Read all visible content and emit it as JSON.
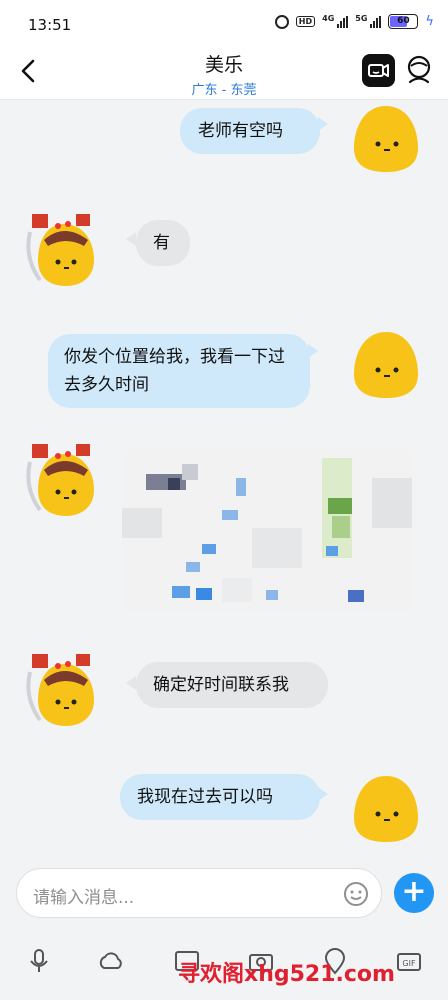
{
  "status_bar": {
    "time": "13:51",
    "hd_label": "HD",
    "network_4g": "4G",
    "network_5g": "5G",
    "battery": "60"
  },
  "header": {
    "title": "美乐",
    "subtitle": "广东 - 东莞"
  },
  "messages": [
    {
      "side": "me",
      "text": "老师有空吗"
    },
    {
      "side": "them",
      "text": "有"
    },
    {
      "side": "me",
      "text": "你发个位置给我，我看一下过去多久时间"
    },
    {
      "side": "them",
      "type": "location-map"
    },
    {
      "side": "them",
      "text": "确定好时间联系我"
    },
    {
      "side": "me",
      "text": "我现在过去可以吗"
    }
  ],
  "input": {
    "placeholder": "请输入消息..."
  },
  "toolbar_icons": [
    "mic-icon",
    "cloud-icon",
    "image-icon",
    "camera-icon",
    "location-icon",
    "gif-icon"
  ],
  "watermark": "寻欢阁xhg521.com",
  "colors": {
    "accent": "#2196f3",
    "my_bubble": "#cfe9fa",
    "their_bubble": "#e5e6e8",
    "subtitle": "#2a7bd6",
    "watermark": "#e0202e"
  }
}
